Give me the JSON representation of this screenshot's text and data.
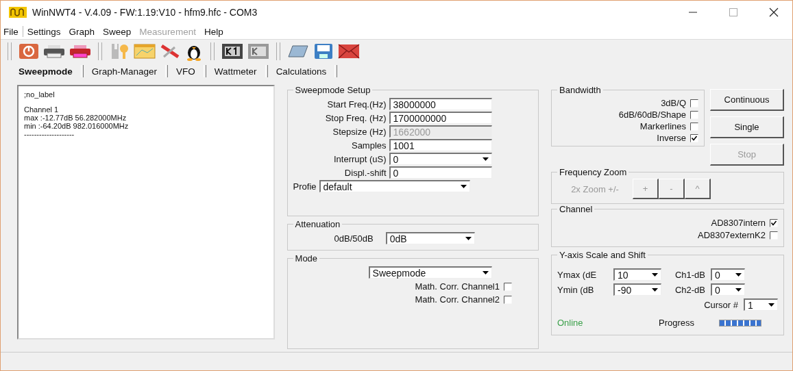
{
  "window": {
    "title": "WinNWT4 - V.4.09 - FW:1.19:V10 - hfm9.hfc - COM3"
  },
  "menu": [
    {
      "label": "File",
      "disabled": false
    },
    {
      "label": "Settings",
      "disabled": false
    },
    {
      "label": "Graph",
      "disabled": false
    },
    {
      "label": "Sweep",
      "disabled": false
    },
    {
      "label": "Measurement",
      "disabled": true
    },
    {
      "label": "Help",
      "disabled": false
    }
  ],
  "tabs": [
    {
      "label": "Sweepmode",
      "selected": true
    },
    {
      "label": "Graph-Manager",
      "selected": false
    },
    {
      "label": "VFO",
      "selected": false
    },
    {
      "label": "Wattmeter",
      "selected": false
    },
    {
      "label": "Calculations",
      "selected": false
    }
  ],
  "log": {
    "header": ";no_label",
    "lines": [
      "Channel 1",
      "max :-12.77dB 56.282000MHz",
      "min :-64.20dB 982.016000MHz",
      "--------------------"
    ]
  },
  "sweep_setup": {
    "title": "Sweepmode Setup",
    "fields": [
      {
        "label": "Start Freq.(Hz)",
        "value": "38000000",
        "kind": "input",
        "disabled": false
      },
      {
        "label": "Stop Freq. (Hz)",
        "value": "1700000000",
        "kind": "input",
        "disabled": false
      },
      {
        "label": "Stepsize (Hz)",
        "value": "1662000",
        "kind": "input",
        "disabled": true
      },
      {
        "label": "Samples",
        "value": "1001",
        "kind": "input",
        "disabled": false
      },
      {
        "label": "Interrupt (uS)",
        "value": "0",
        "kind": "dropdown",
        "disabled": false
      },
      {
        "label": "Displ.-shift",
        "value": "0",
        "kind": "input",
        "disabled": false
      },
      {
        "label": "Profie",
        "value": "default",
        "kind": "dropdown",
        "disabled": false
      }
    ]
  },
  "attenuation": {
    "title": "Attenuation",
    "label": "0dB/50dB",
    "value": "0dB"
  },
  "mode": {
    "title": "Mode",
    "value": "Sweepmode",
    "checks": [
      {
        "label": "Math. Corr. Channel1",
        "checked": false
      },
      {
        "label": "Math. Corr. Channel2",
        "checked": false
      }
    ]
  },
  "bandwidth": {
    "title": "Bandwidth",
    "checks": [
      {
        "label": "3dB/Q",
        "checked": false
      },
      {
        "label": "6dB/60dB/Shape",
        "checked": false
      },
      {
        "label": "Markerlines",
        "checked": false
      },
      {
        "label": "Inverse",
        "checked": true
      }
    ]
  },
  "sweep_buttons": [
    {
      "label": "Continuous",
      "disabled": false
    },
    {
      "label": "Single",
      "disabled": false
    },
    {
      "label": "Stop",
      "disabled": true
    }
  ],
  "frequency_zoom": {
    "title": "Frequency Zoom",
    "label": "2x Zoom +/-",
    "disabled": true,
    "buttons": [
      "+",
      "-",
      "^"
    ]
  },
  "channel": {
    "title": "Channel",
    "checks": [
      {
        "label": "AD8307intern",
        "checked": true
      },
      {
        "label": "AD8307externK2",
        "checked": false
      }
    ]
  },
  "y_axis": {
    "title": "Y-axis Scale and Shift",
    "rows": [
      {
        "label": "Ymax (dE",
        "value": "10",
        "label_2": "Ch1-dB",
        "value_2": "0"
      },
      {
        "label": "Ymin (dB",
        "value": "-90",
        "label_2": "Ch2-dB",
        "value_2": "0"
      }
    ],
    "cursor_label": "Cursor #",
    "cursor_value": "1"
  },
  "status": {
    "state": "Online",
    "online": true,
    "progress_label": "Progress",
    "progress": {
      "level": 1
    }
  }
}
